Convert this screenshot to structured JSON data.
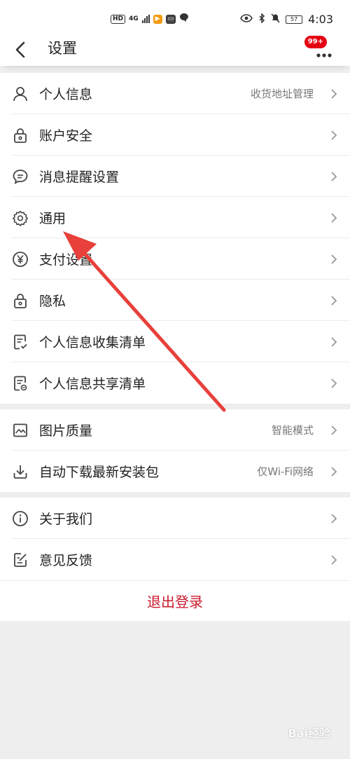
{
  "status_bar": {
    "left_chips": [
      "HD",
      "4G"
    ],
    "time": "4:03",
    "battery": "57"
  },
  "header": {
    "title": "设置",
    "badge": "99+"
  },
  "groups": [
    {
      "items": [
        {
          "label": "个人信息",
          "value": "收货地址管理",
          "icon": "person-icon"
        },
        {
          "label": "账户安全",
          "value": "",
          "icon": "lock-icon"
        },
        {
          "label": "消息提醒设置",
          "value": "",
          "icon": "chat-bubble-icon"
        },
        {
          "label": "通用",
          "value": "",
          "icon": "gear-icon"
        },
        {
          "label": "支付设置",
          "value": "",
          "icon": "yen-icon"
        },
        {
          "label": "隐私",
          "value": "",
          "icon": "privacy-lock-icon"
        },
        {
          "label": "个人信息收集清单",
          "value": "",
          "icon": "checklist-icon"
        },
        {
          "label": "个人信息共享清单",
          "value": "",
          "icon": "share-list-icon"
        }
      ]
    },
    {
      "items": [
        {
          "label": "图片质量",
          "value": "智能模式",
          "icon": "image-icon"
        },
        {
          "label": "自动下载最新安装包",
          "value": "仅Wi-Fi网络",
          "icon": "download-icon"
        }
      ]
    },
    {
      "items": [
        {
          "label": "关于我们",
          "value": "",
          "icon": "info-icon"
        },
        {
          "label": "意见反馈",
          "value": "",
          "icon": "feedback-icon"
        }
      ]
    }
  ],
  "logout": {
    "label": "退出登录"
  },
  "watermark": "Bai经验"
}
